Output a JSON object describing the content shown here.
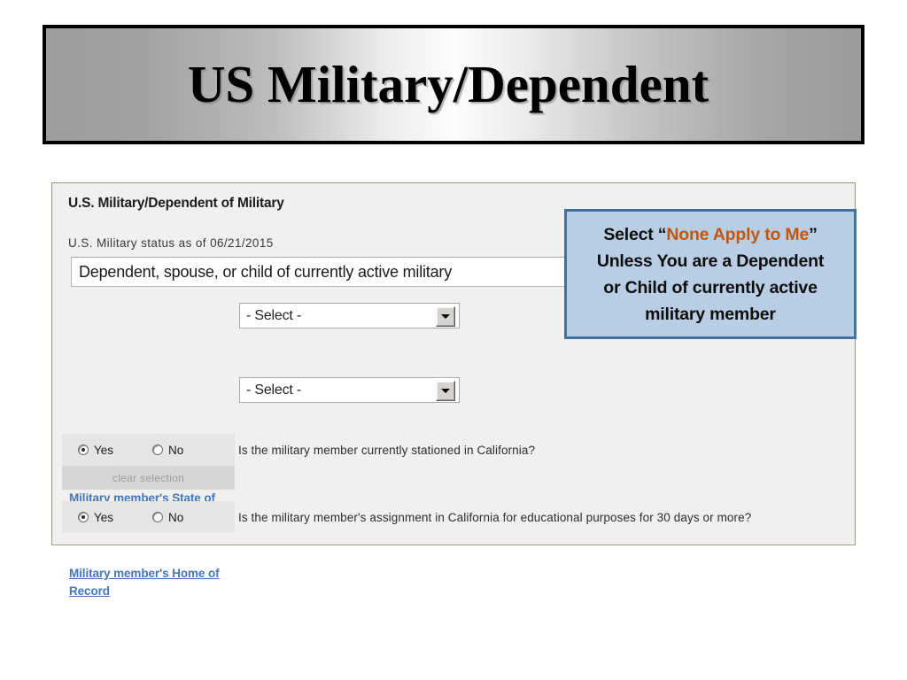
{
  "slide": {
    "title": "US Military/Dependent"
  },
  "form": {
    "heading": "U.S. Military/Dependent of Military",
    "status_label": "U.S. Military status as of 06/21/2015",
    "status_value": "Dependent, spouse, or child of currently active military",
    "fields": [
      {
        "label": "Military member's State of Legal Residence (military)",
        "value": "- Select -",
        "arrow_icon": "chevron-down-icon"
      },
      {
        "label": "Military member's Home of Record",
        "value": "- Select -",
        "arrow_icon": "chevron-down-icon"
      }
    ],
    "clear_selection_label": "clear selection",
    "radio_options": {
      "yes": "Yes",
      "no": "No"
    },
    "questions": [
      {
        "text": "Is the military member currently stationed in California?",
        "selected": "Yes"
      },
      {
        "text": "Is the military member's assignment in California for educational purposes for 30 days or more?",
        "selected": "Yes"
      }
    ]
  },
  "callout": {
    "line1_prefix": "Select “",
    "line1_highlight": "None Apply to Me",
    "line1_suffix": "”",
    "line2": "Unless You are a Dependent",
    "line3": "or Child of currently active",
    "line4": "military member",
    "colors": {
      "fill": "#b9cde4",
      "border": "#41719c",
      "highlight_text": "#c0570f",
      "body_text": "#0d0d0d"
    }
  },
  "theme": {
    "panel_background": "#f1f0ee",
    "panel_border": "#9c9a7e",
    "link_color": "#4576b5",
    "radio_row_background": "#e5e5e5",
    "clear_bar_background": "#d6d6d6"
  }
}
